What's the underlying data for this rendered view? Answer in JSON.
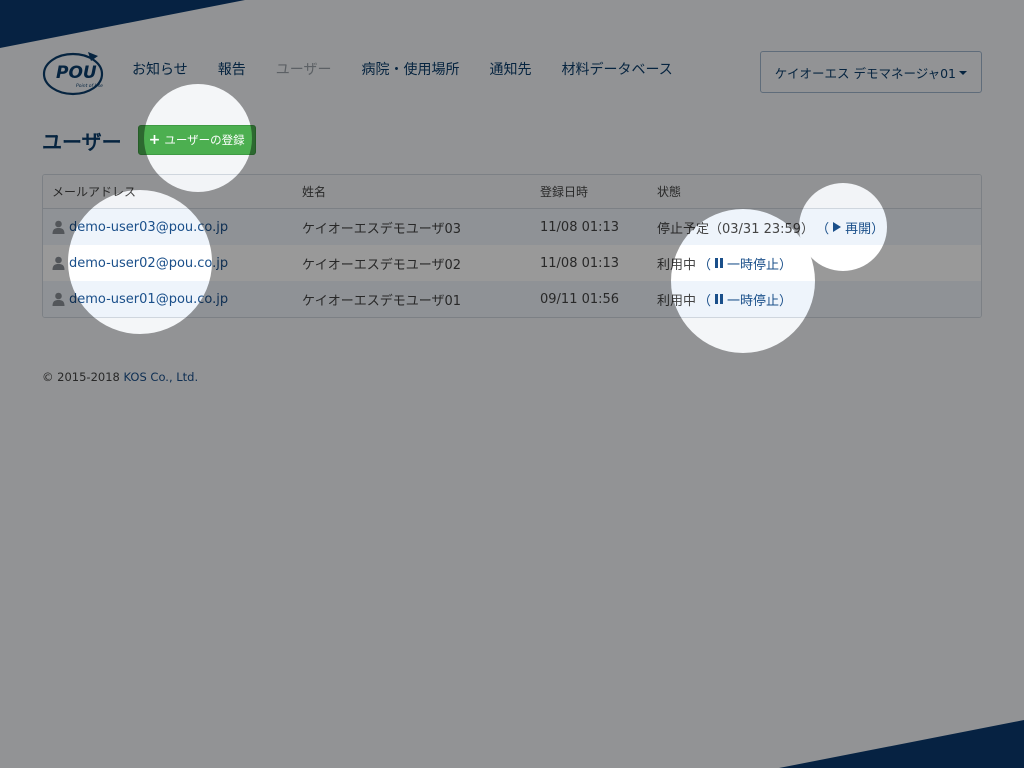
{
  "header": {
    "logo_text": "POU",
    "logo_subtext": "Point of Use",
    "nav": [
      {
        "label": "お知らせ"
      },
      {
        "label": "報告"
      },
      {
        "label": "ユーザー"
      },
      {
        "label": "病院・使用場所"
      },
      {
        "label": "通知先"
      },
      {
        "label": "材料データベース"
      }
    ],
    "active_nav": "ユーザー",
    "user_menu_label": "ケイオーエス デモマネージャ01"
  },
  "page": {
    "title": "ユーザー",
    "add_button_label": "ユーザーの登録"
  },
  "table": {
    "headers": [
      "メールアドレス",
      "姓名",
      "登録日時",
      "状態"
    ],
    "rows": [
      {
        "email": "demo-user03@pou.co.jp",
        "name": "ケイオーエスデモユーザ03",
        "registered": "11/08 01:13",
        "status": "停止予定（03/31 23:59）",
        "action_open": "（",
        "action_label": "再開",
        "action_close": "）",
        "action_icon": "play-icon"
      },
      {
        "email": "demo-user02@pou.co.jp",
        "name": "ケイオーエスデモユーザ02",
        "registered": "11/08 01:13",
        "status": "利用中",
        "action_open": "（",
        "action_label": "一時停止",
        "action_close": "）",
        "action_icon": "pause-icon"
      },
      {
        "email": "demo-user01@pou.co.jp",
        "name": "ケイオーエスデモユーザ01",
        "registered": "09/11 01:56",
        "status": "利用中",
        "action_open": "（",
        "action_label": "一時停止",
        "action_close": "）",
        "action_icon": "pause-icon"
      }
    ]
  },
  "footer": {
    "copyright": "© 2015-2018 ",
    "company_link": "KOS Co., Ltd."
  },
  "colors": {
    "brand_navy": "#0a3a6e",
    "link_blue": "#1a4f8a",
    "button_green": "#4caf50",
    "overlay_dim": "rgba(0,0,0,0.40)"
  }
}
